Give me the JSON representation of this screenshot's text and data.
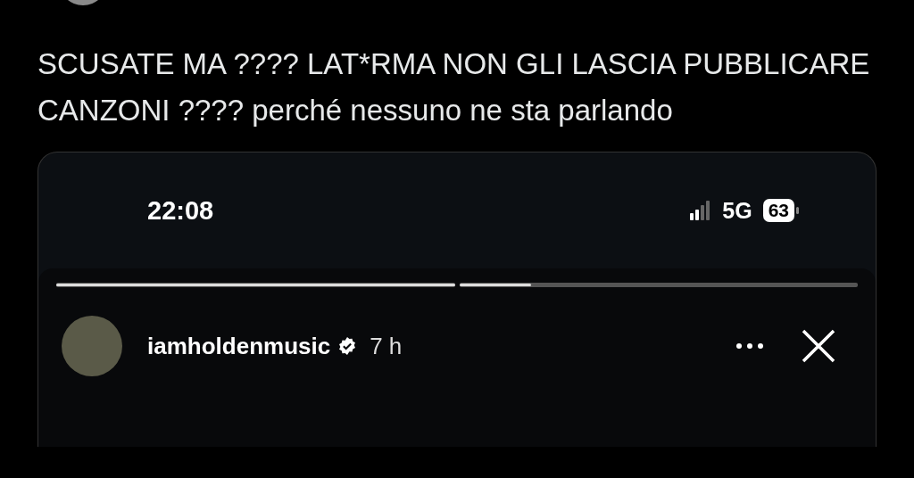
{
  "post": {
    "text": "SCUSATE MA ???? LAT*RMA NON GLI LASCIA PUBBLICARE CANZONI ???? perché nessuno ne sta parlando"
  },
  "story": {
    "status_bar": {
      "time": "22:08",
      "network": "5G",
      "battery": "63"
    },
    "progress": [
      {
        "level": 1
      },
      {
        "level": 0.18
      }
    ],
    "user": {
      "name": "iamholdenmusic",
      "verified": true,
      "time": "7 h"
    }
  }
}
